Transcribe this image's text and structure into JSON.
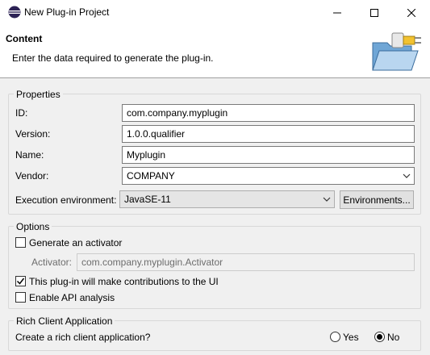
{
  "window": {
    "title": "New Plug-in Project"
  },
  "header": {
    "title": "Content",
    "description": "Enter the data required to generate the plug-in."
  },
  "properties": {
    "group_label": "Properties",
    "id_label": "ID:",
    "id_value": "com.company.myplugin",
    "version_label": "Version:",
    "version_value": "1.0.0.qualifier",
    "name_label": "Name:",
    "name_value": "Myplugin",
    "vendor_label": "Vendor:",
    "vendor_value": "COMPANY",
    "exec_env_label": "Execution environment:",
    "exec_env_value": "JavaSE-11",
    "environments_button": "Environments..."
  },
  "options": {
    "group_label": "Options",
    "generate_activator_label": "Generate an activator",
    "generate_activator_checked": false,
    "activator_label": "Activator:",
    "activator_value": "com.company.myplugin.Activator",
    "contributions_label": "This plug-in will make contributions to the UI",
    "contributions_checked": true,
    "api_analysis_label": "Enable API analysis",
    "api_analysis_checked": false
  },
  "rca": {
    "group_label": "Rich Client Application",
    "question": "Create a rich client application?",
    "yes_label": "Yes",
    "no_label": "No",
    "selected": "No"
  }
}
